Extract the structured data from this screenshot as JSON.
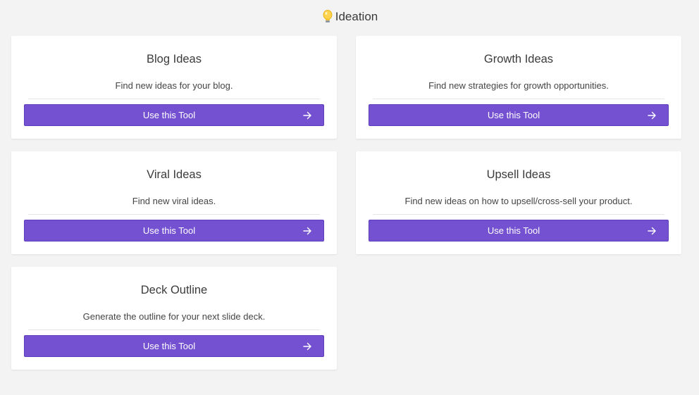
{
  "header": {
    "title": "Ideation",
    "icon": "lightbulb-icon"
  },
  "theme": {
    "accent": "#7451d1",
    "background": "#f3f3f3",
    "card": "#ffffff"
  },
  "cards": [
    {
      "title": "Blog Ideas",
      "description": "Find new ideas for your blog.",
      "button_label": "Use this Tool",
      "button_icon": "arrow-right-icon"
    },
    {
      "title": "Growth Ideas",
      "description": "Find new strategies for growth opportunities.",
      "button_label": "Use this Tool",
      "button_icon": "arrow-right-icon"
    },
    {
      "title": "Viral Ideas",
      "description": "Find new viral ideas.",
      "button_label": "Use this Tool",
      "button_icon": "arrow-right-icon"
    },
    {
      "title": "Upsell Ideas",
      "description": "Find new ideas on how to upsell/cross-sell your product.",
      "button_label": "Use this Tool",
      "button_icon": "arrow-right-icon"
    },
    {
      "title": "Deck Outline",
      "description": "Generate the outline for your next slide deck.",
      "button_label": "Use this Tool",
      "button_icon": "arrow-right-icon"
    }
  ]
}
